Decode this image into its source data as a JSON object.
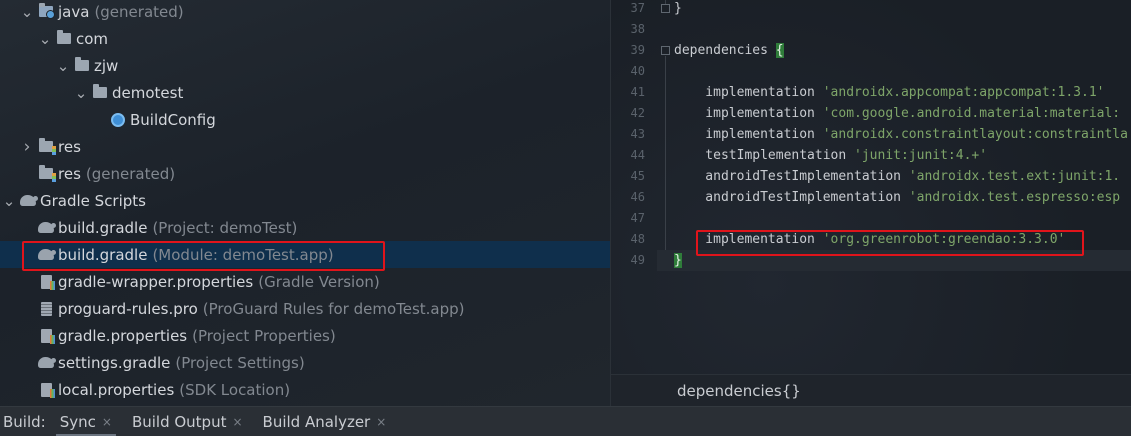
{
  "tree": {
    "rows": [
      {
        "name": "java",
        "hint": "(generated)",
        "expanded": true,
        "icon": "source-folder-icon"
      },
      {
        "name": "com",
        "hint": "",
        "expanded": true,
        "icon": "package-icon"
      },
      {
        "name": "zjw",
        "hint": "",
        "expanded": true,
        "icon": "package-icon"
      },
      {
        "name": "demotest",
        "hint": "",
        "expanded": true,
        "icon": "package-icon"
      },
      {
        "name": "BuildConfig",
        "hint": "",
        "expanded": null,
        "icon": "class-icon"
      },
      {
        "name": "res",
        "hint": "",
        "expanded": false,
        "icon": "resource-folder-icon"
      },
      {
        "name": "res",
        "hint": "(generated)",
        "expanded": null,
        "icon": "resource-folder-icon"
      },
      {
        "name": "Gradle Scripts",
        "hint": "",
        "expanded": true,
        "icon": "gradle-icon"
      },
      {
        "name": "build.gradle",
        "hint": "(Project: demoTest)",
        "expanded": null,
        "icon": "gradle-icon"
      },
      {
        "name": "build.gradle",
        "hint": "(Module: demoTest.app)",
        "expanded": null,
        "icon": "gradle-icon",
        "selected": true
      },
      {
        "name": "gradle-wrapper.properties",
        "hint": "(Gradle Version)",
        "expanded": null,
        "icon": "properties-file-icon"
      },
      {
        "name": "proguard-rules.pro",
        "hint": "(ProGuard Rules for demoTest.app)",
        "expanded": null,
        "icon": "text-file-icon"
      },
      {
        "name": "gradle.properties",
        "hint": "(Project Properties)",
        "expanded": null,
        "icon": "properties-file-icon"
      },
      {
        "name": "settings.gradle",
        "hint": "(Project Settings)",
        "expanded": null,
        "icon": "gradle-icon"
      },
      {
        "name": "local.properties",
        "hint": "(SDK Location)",
        "expanded": null,
        "icon": "properties-file-icon"
      }
    ]
  },
  "editor": {
    "lines": [
      {
        "n": "37",
        "parts": [
          {
            "t": "}",
            "c": "kw"
          }
        ]
      },
      {
        "n": "38",
        "parts": []
      },
      {
        "n": "39",
        "parts": [
          {
            "t": "dependencies ",
            "c": "kw"
          },
          {
            "t": "{",
            "c": "brace-hl"
          }
        ]
      },
      {
        "n": "40",
        "parts": []
      },
      {
        "n": "41",
        "parts": [
          {
            "t": "    implementation ",
            "c": "kw"
          },
          {
            "t": "'androidx.appcompat:appcompat:1.3.1'",
            "c": "str"
          }
        ]
      },
      {
        "n": "42",
        "parts": [
          {
            "t": "    implementation ",
            "c": "kw"
          },
          {
            "t": "'com.google.android.material:material:",
            "c": "str"
          }
        ]
      },
      {
        "n": "43",
        "parts": [
          {
            "t": "    implementation ",
            "c": "kw"
          },
          {
            "t": "'androidx.constraintlayout:constraintla",
            "c": "str"
          }
        ]
      },
      {
        "n": "44",
        "parts": [
          {
            "t": "    testImplementation ",
            "c": "kw"
          },
          {
            "t": "'junit:junit:4.+'",
            "c": "str"
          }
        ]
      },
      {
        "n": "45",
        "parts": [
          {
            "t": "    androidTestImplementation ",
            "c": "kw"
          },
          {
            "t": "'androidx.test.ext:junit:1.",
            "c": "str"
          }
        ]
      },
      {
        "n": "46",
        "parts": [
          {
            "t": "    androidTestImplementation ",
            "c": "kw"
          },
          {
            "t": "'androidx.test.espresso:esp",
            "c": "str"
          }
        ]
      },
      {
        "n": "47",
        "parts": []
      },
      {
        "n": "48",
        "parts": [
          {
            "t": "    implementation ",
            "c": "kw"
          },
          {
            "t": "'org.greenrobot:greendao:3.3.0'",
            "c": "str"
          }
        ]
      },
      {
        "n": "49",
        "parts": [
          {
            "t": "}",
            "c": "brace-hl"
          }
        ],
        "current": true
      }
    ],
    "breadcrumb": "dependencies{}"
  },
  "bottombar": {
    "label": "Build:",
    "tabs": [
      {
        "label": "Sync",
        "active": true
      },
      {
        "label": "Build Output",
        "active": false
      },
      {
        "label": "Build Analyzer",
        "active": false
      }
    ],
    "close_glyph": "×"
  },
  "colors": {
    "highlight_box": "#e0141b",
    "selection": "#0f2f4c",
    "string": "#7ea569",
    "brace_match": "#2f7d3a"
  }
}
